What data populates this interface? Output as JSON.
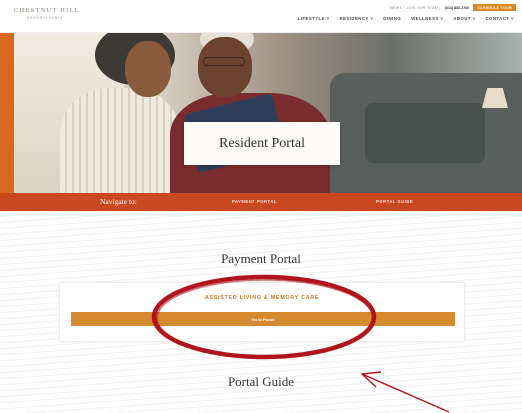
{
  "header": {
    "logo_main": "CHESTNUT HILL",
    "logo_sub": "PENNSYLVANIA",
    "utility_text": "NEWS | JOIN OUR TEAM |",
    "phone": "(314) 833-3760",
    "schedule_label": "SCHEDULE TOUR"
  },
  "nav": {
    "items": [
      {
        "label": "LIFESTYLE ˅"
      },
      {
        "label": "RESIDENCY ˅"
      },
      {
        "label": "DINING"
      },
      {
        "label": "WELLNESS ˅"
      },
      {
        "label": "ABOUT ˅"
      },
      {
        "label": "CONTACT ˅"
      }
    ]
  },
  "hero": {
    "title": "Resident Portal"
  },
  "navigate_bar": {
    "label": "Navigate to:",
    "links": [
      "PAYMENT PORTAL",
      "PORTAL GUIDE"
    ]
  },
  "payment": {
    "title": "Payment Portal",
    "card_heading": "ASSISTED LIVING & MEMORY CARE",
    "button_label": "Go to Portal"
  },
  "guide": {
    "title": "Portal Guide"
  },
  "colors": {
    "accent_orange": "#d68a2f",
    "navbar_rust": "#c9481f",
    "annotation_red": "#b0151d"
  }
}
